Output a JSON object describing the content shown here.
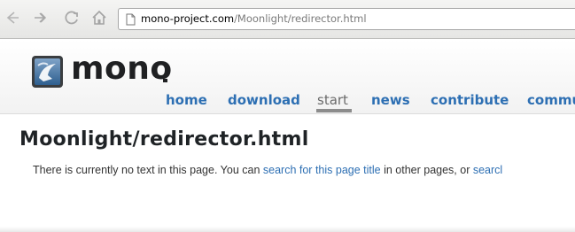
{
  "browser": {
    "url_domain": "mono-project.com",
    "url_path": "/Moonlight/redirector.html"
  },
  "site": {
    "logo_text": "mono",
    "nav": [
      {
        "label": "home"
      },
      {
        "label": "download"
      },
      {
        "label": "start",
        "active": true
      },
      {
        "label": "news"
      },
      {
        "label": "contribute"
      },
      {
        "label": "commu"
      }
    ]
  },
  "page": {
    "title": "Moonlight/redirector.html",
    "text_before": "There is currently no text in this page. You can ",
    "link1": "search for this page title",
    "text_middle": " in other pages, or ",
    "link2": "searcl"
  },
  "colors": {
    "link": "#2d6fb3",
    "active_nav": "#6b6b6b"
  }
}
